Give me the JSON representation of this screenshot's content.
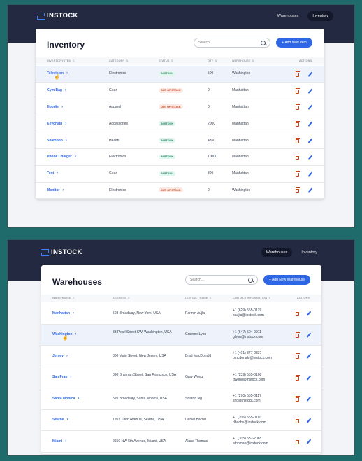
{
  "brand": "INSTOCK",
  "nav": {
    "warehouses": "Warehouses",
    "inventory": "Inventory"
  },
  "inventory_page": {
    "title": "Inventory",
    "search_placeholder": "Search...",
    "add_label": "+ Add New Item",
    "columns": [
      "INVENTORY ITEM",
      "CATEGORY",
      "STATUS",
      "QTY",
      "WAREHOUSE",
      "ACTIONS"
    ],
    "rows": [
      {
        "item": "Television",
        "category": "Electronics",
        "status": "IN STOCK",
        "qty": "500",
        "warehouse": "Washington"
      },
      {
        "item": "Gym Bag",
        "category": "Gear",
        "status": "OUT OF STOCK",
        "qty": "0",
        "warehouse": "Manhattan"
      },
      {
        "item": "Hoodie",
        "category": "Apparel",
        "status": "OUT OF STOCK",
        "qty": "0",
        "warehouse": "Manhattan"
      },
      {
        "item": "Keychain",
        "category": "Accessories",
        "status": "IN STOCK",
        "qty": "2000",
        "warehouse": "Manhattan"
      },
      {
        "item": "Shampoo",
        "category": "Health",
        "status": "IN STOCK",
        "qty": "4350",
        "warehouse": "Manhattan"
      },
      {
        "item": "Phone Charger",
        "category": "Electronics",
        "status": "IN STOCK",
        "qty": "10000",
        "warehouse": "Manhattan"
      },
      {
        "item": "Tent",
        "category": "Gear",
        "status": "IN STOCK",
        "qty": "800",
        "warehouse": "Manhattan"
      },
      {
        "item": "Monitor",
        "category": "Electronics",
        "status": "OUT OF STOCK",
        "qty": "0",
        "warehouse": "Washington"
      }
    ]
  },
  "warehouses_page": {
    "title": "Warehouses",
    "search_placeholder": "Search...",
    "add_label": "+ Add New Warehouse",
    "columns": [
      "WAREHOUSE",
      "ADDRESS",
      "CONTACT NAME",
      "CONTACT INFORMATION",
      "ACTIONS"
    ],
    "rows": [
      {
        "name": "Manhattan",
        "address": "503 Broadway, New York, USA",
        "contact": "Parmin Aujla",
        "phone": "+1 (629) 555-0129",
        "email": "paujla@instock.com"
      },
      {
        "name": "Washington",
        "address": "33 Pearl Street SW, Washington, USA",
        "contact": "Graeme Lyon",
        "phone": "+1 (647) 504-0911",
        "email": "glyon@instock.com"
      },
      {
        "name": "Jersey",
        "address": "300 Main Street, New Jersey, USA",
        "contact": "Brad MacDonald",
        "phone": "+1 (401) 377-2337",
        "email": "bmcdonald@instock.com"
      },
      {
        "name": "San Fran",
        "address": "890 Brannan Street, San Francisco, USA",
        "contact": "Gary Wong",
        "phone": "+1 (239) 555-0108",
        "email": "gwong@instock.com"
      },
      {
        "name": "Santa Monica",
        "address": "520 Broadway, Santa Monica, USA",
        "contact": "Sharon Ng",
        "phone": "+1 (270) 555-0117",
        "email": "sng@instock.com"
      },
      {
        "name": "Seattle",
        "address": "1201 Third Avenue, Seattle, USA",
        "contact": "Daniel Bachu",
        "phone": "+1 (206) 555-0103",
        "email": "dbachu@instock.com"
      },
      {
        "name": "Miami",
        "address": "2650 NW 5th Avenue, Miami, USA",
        "contact": "Alana Thomas",
        "phone": "+1 (305) 532-2065",
        "email": "athomas@instock.com"
      }
    ]
  },
  "colors": {
    "header": "#232940",
    "accent": "#2e66e6",
    "in_stock": "#158463",
    "out_of_stock": "#c94515"
  }
}
